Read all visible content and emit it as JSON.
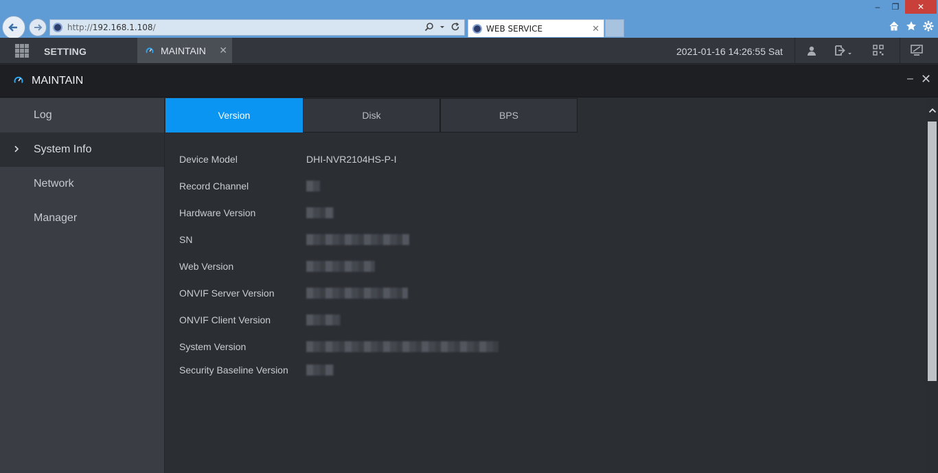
{
  "browser": {
    "url_prefix": "http://",
    "url_host": "192.168.1.108",
    "url_suffix": "/",
    "tab_title": "WEB SERVICE",
    "tab_close": "✕",
    "window_min": "–",
    "window_max": "❐",
    "window_close": "✕",
    "icons": [
      "back-icon",
      "forward-icon",
      "search-icon",
      "refresh-icon",
      "home-icon",
      "star-icon",
      "gear-icon"
    ]
  },
  "app_bar": {
    "setting_label": "SETTING",
    "tab_label": "MAINTAIN",
    "tab_close": "✕",
    "datetime": "2021-01-16 14:26:55 Sat"
  },
  "window": {
    "title": "MAINTAIN",
    "minimize": "–",
    "close": "✕"
  },
  "sidebar": {
    "items": [
      {
        "label": "Log",
        "active": false
      },
      {
        "label": "System Info",
        "active": true
      },
      {
        "label": "Network",
        "active": false
      },
      {
        "label": "Manager",
        "active": false
      }
    ]
  },
  "tabs": [
    {
      "label": "Version",
      "active": true
    },
    {
      "label": "Disk",
      "active": false
    },
    {
      "label": "BPS",
      "active": false
    }
  ],
  "info": {
    "rows": [
      {
        "label": "Device Model",
        "value": "DHI-NVR2104HS-P-I"
      },
      {
        "label": "Record Channel",
        "value": ""
      },
      {
        "label": "Hardware Version",
        "value": ""
      },
      {
        "label": "SN",
        "value": ""
      },
      {
        "label": "Web Version",
        "value": ""
      },
      {
        "label": "ONVIF Server Version",
        "value": ""
      },
      {
        "label": "ONVIF Client Version",
        "value": ""
      },
      {
        "label": "System Version",
        "value": ""
      },
      {
        "label": "Security Baseline Version",
        "value": ""
      }
    ]
  },
  "colors": {
    "accent": "#0b95f3",
    "sidebar_bg": "#3a3d43",
    "content_bg": "#2b2e33",
    "header_bg": "#1d1f23"
  }
}
